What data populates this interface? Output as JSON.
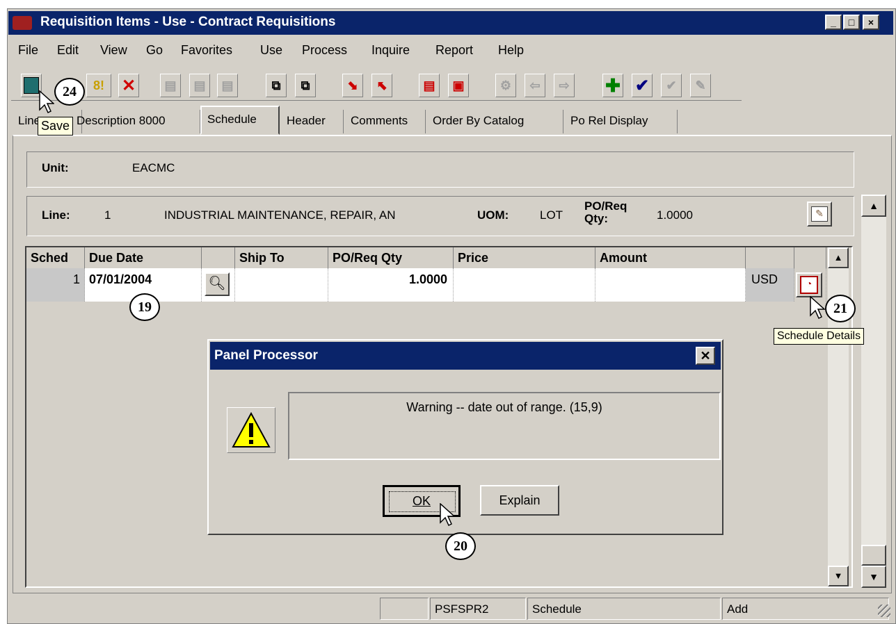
{
  "window": {
    "title": "Requisition Items - Use - Contract Requisitions",
    "controls": [
      "_",
      "□",
      "×"
    ]
  },
  "menu": [
    "File",
    "Edit",
    "View",
    "Go",
    "Favorites",
    "Use",
    "Process",
    "Inquire",
    "Report",
    "Help"
  ],
  "toolbar": {
    "save_tooltip": "Save"
  },
  "tabs": [
    "Line",
    "Description 8000",
    "Schedule",
    "Header",
    "Comments",
    "Order By Catalog",
    "Po Rel Display"
  ],
  "unit": {
    "label": "Unit:",
    "value": "EACMC"
  },
  "line": {
    "label": "Line:",
    "number": "1",
    "description": "INDUSTRIAL MAINTENANCE, REPAIR, AN",
    "uom_label": "UOM:",
    "uom_value": "LOT",
    "qty_label": "PO/Req Qty:",
    "qty_value": "1.0000"
  },
  "grid": {
    "headers": [
      "Sched",
      "Due Date",
      "",
      "Ship To",
      "PO/Req Qty",
      "Price",
      "Amount",
      "",
      ""
    ],
    "row": {
      "sched": "1",
      "due_date": "07/01/2004",
      "ship_to": "",
      "qty": "1.0000",
      "price": "",
      "amount": "",
      "currency": "USD"
    }
  },
  "schedule_details_tooltip": "Schedule Details",
  "dialog": {
    "title": "Panel Processor",
    "message": "Warning -- date out of range. (15,9)",
    "ok_label": "OK",
    "explain_label": "Explain"
  },
  "callouts": {
    "save": "24",
    "due_date": "19",
    "schedule": "21",
    "ok": "20"
  },
  "status": {
    "cell1": "",
    "cell2": "PSFSPR2",
    "cell3": "Schedule",
    "cell4": "Add"
  }
}
